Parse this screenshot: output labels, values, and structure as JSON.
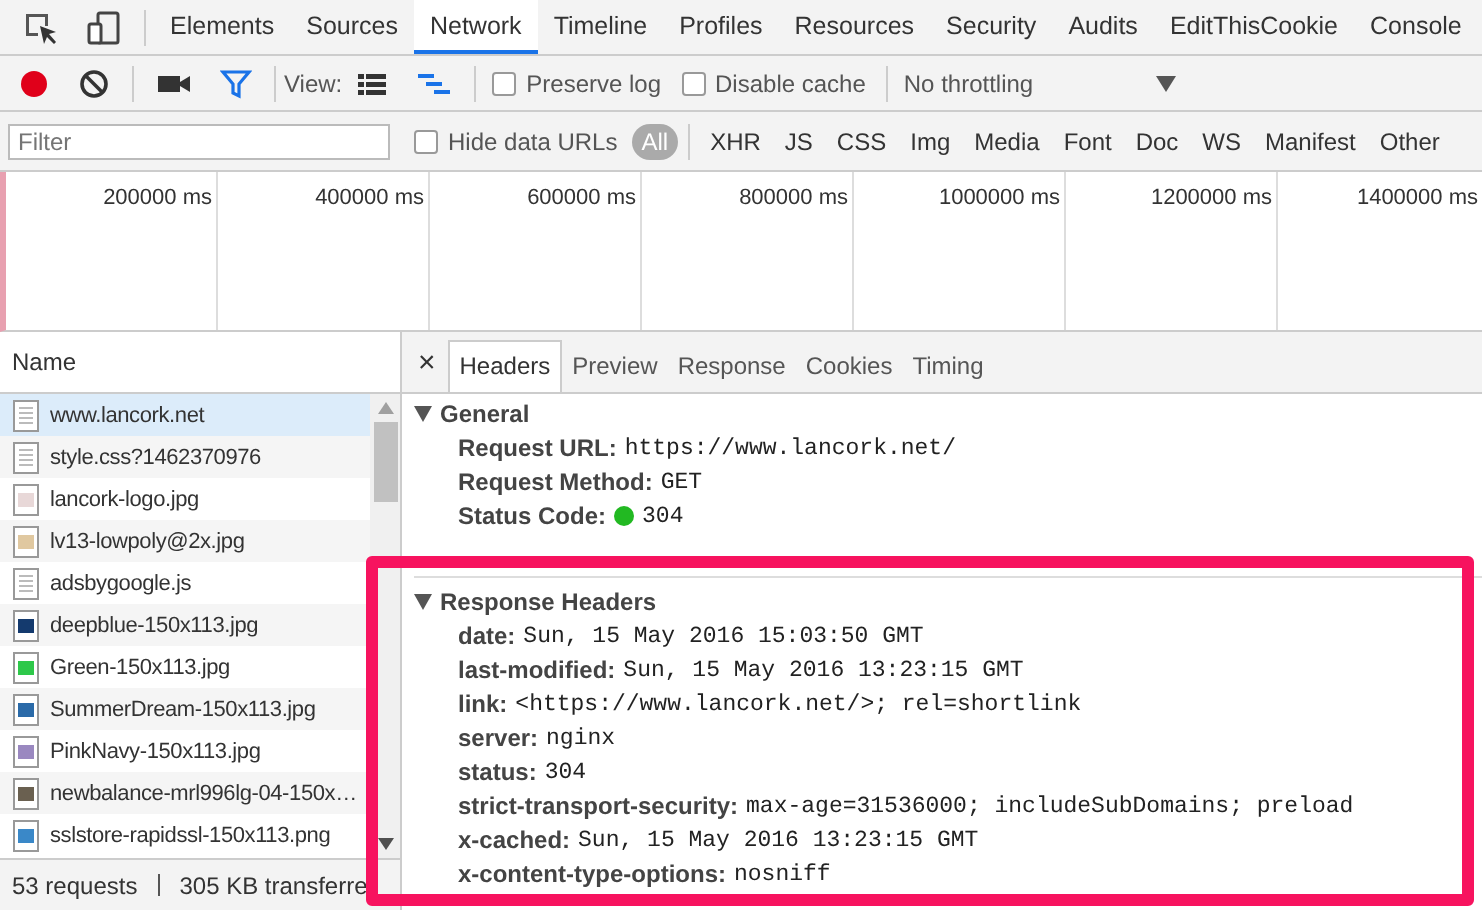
{
  "panel_tabs": [
    {
      "label": "Elements",
      "selected": false
    },
    {
      "label": "Sources",
      "selected": false
    },
    {
      "label": "Network",
      "selected": true
    },
    {
      "label": "Timeline",
      "selected": false
    },
    {
      "label": "Profiles",
      "selected": false
    },
    {
      "label": "Resources",
      "selected": false
    },
    {
      "label": "Security",
      "selected": false
    },
    {
      "label": "Audits",
      "selected": false
    },
    {
      "label": "EditThisCookie",
      "selected": false
    },
    {
      "label": "Console",
      "selected": false
    }
  ],
  "toolbar": {
    "recording": true,
    "filter_on": true,
    "view_label": "View:",
    "large_rows": false,
    "overview": true,
    "options": [
      {
        "label": "Preserve log",
        "checked": false
      },
      {
        "label": "Disable cache",
        "checked": false
      }
    ],
    "throttling": "No throttling"
  },
  "filter_bar": {
    "placeholder": "Filter",
    "hide_data_urls": {
      "label": "Hide data URLs",
      "checked": false
    },
    "types": [
      {
        "label": "All",
        "selected": true
      },
      {
        "label": "XHR",
        "selected": false
      },
      {
        "label": "JS",
        "selected": false
      },
      {
        "label": "CSS",
        "selected": false
      },
      {
        "label": "Img",
        "selected": false
      },
      {
        "label": "Media",
        "selected": false
      },
      {
        "label": "Font",
        "selected": false
      },
      {
        "label": "Doc",
        "selected": false
      },
      {
        "label": "WS",
        "selected": false
      },
      {
        "label": "Manifest",
        "selected": false
      },
      {
        "label": "Other",
        "selected": false
      }
    ]
  },
  "overview": {
    "ticks": [
      "200000 ms",
      "400000 ms",
      "600000 ms",
      "800000 ms",
      "1000000 ms",
      "1200000 ms",
      "1400000 ms"
    ]
  },
  "requests": {
    "column": "Name",
    "rows": [
      {
        "name": "www.lancork.net",
        "kind": "document",
        "selected": true
      },
      {
        "name": "style.css?1462370976",
        "kind": "document",
        "selected": false
      },
      {
        "name": "lancork-logo.jpg",
        "kind": "image",
        "color": "#e8d8d8",
        "selected": false
      },
      {
        "name": "lv13-lowpoly@2x.jpg",
        "kind": "image",
        "color": "#e0c8a0",
        "selected": false
      },
      {
        "name": "adsbygoogle.js",
        "kind": "document",
        "selected": false
      },
      {
        "name": "deepblue-150x113.jpg",
        "kind": "image",
        "color": "#143a6e",
        "selected": false
      },
      {
        "name": "Green-150x113.jpg",
        "kind": "image",
        "color": "#2ec84a",
        "selected": false
      },
      {
        "name": "SummerDream-150x113.jpg",
        "kind": "image",
        "color": "#2a6aa8",
        "selected": false
      },
      {
        "name": "PinkNavy-150x113.jpg",
        "kind": "image",
        "color": "#9a88c0",
        "selected": false
      },
      {
        "name": "newbalance-mrl996lg-04-150x…",
        "kind": "image",
        "color": "#6a6050",
        "selected": false
      },
      {
        "name": "sslstore-rapidssl-150x113.png",
        "kind": "image",
        "color": "#3a88c8",
        "selected": false
      }
    ],
    "summary": [
      "53 requests",
      "305 KB transferre"
    ]
  },
  "close_label": "×",
  "detail_tabs": [
    {
      "label": "Headers",
      "selected": true
    },
    {
      "label": "Preview",
      "selected": false
    },
    {
      "label": "Response",
      "selected": false
    },
    {
      "label": "Cookies",
      "selected": false
    },
    {
      "label": "Timing",
      "selected": false
    }
  ],
  "sections": [
    {
      "title": "General",
      "expanded": true,
      "items": [
        {
          "name": "Request URL:",
          "value": "https://www.lancork.net/"
        },
        {
          "name": "Request Method:",
          "value": "GET"
        },
        {
          "name": "Status Code:",
          "value": "304",
          "color": "#22b922"
        }
      ]
    },
    {
      "title": "Response Headers",
      "expanded": true,
      "items": [
        {
          "name": "date:",
          "value": "Sun, 15 May 2016 15:03:50 GMT"
        },
        {
          "name": "last-modified:",
          "value": "Sun, 15 May 2016 13:23:15 GMT"
        },
        {
          "name": "link:",
          "value": "<https://www.lancork.net/>; rel=shortlink"
        },
        {
          "name": "server:",
          "value": "nginx"
        },
        {
          "name": "status:",
          "value": "304"
        },
        {
          "name": "strict-transport-security:",
          "value": "max-age=31536000; includeSubDomains; preload"
        },
        {
          "name": "x-cached:",
          "value": "Sun, 15 May 2016 13:23:15 GMT"
        },
        {
          "name": "x-content-type-options:",
          "value": "nosniff"
        }
      ]
    }
  ],
  "annotation": {
    "color": "#f7135f"
  }
}
